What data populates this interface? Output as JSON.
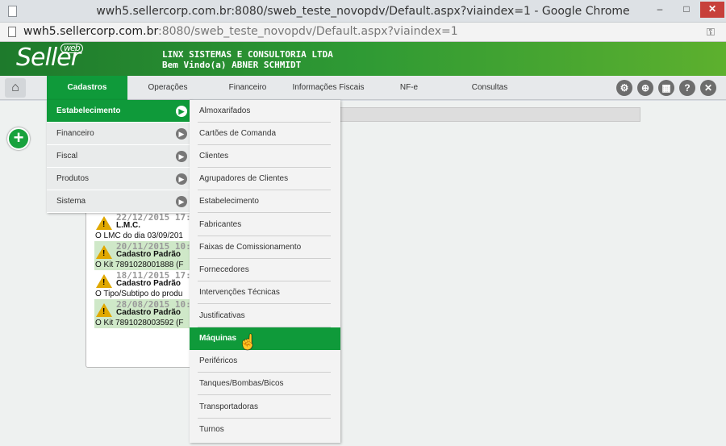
{
  "window": {
    "title": "wwh5.sellercorp.com.br:8080/sweb_teste_novopdv/Default.aspx?viaindex=1 - Google Chrome",
    "minimize": "–",
    "maximize": "□",
    "close": "✕"
  },
  "address": {
    "host": "wwh5.sellercorp.com.br",
    "path": ":8080/sweb_teste_novopdv/Default.aspx?viaindex=1"
  },
  "header": {
    "logo": "Seller",
    "logo_badge": "web",
    "company": "LINX SISTEMAS E CONSULTORIA LTDA",
    "welcome": "Bem Vindo(a) ABNER SCHMIDT"
  },
  "nav": {
    "items": [
      "Cadastros",
      "Operações",
      "Financeiro",
      "Informações Fiscais",
      "NF-e",
      "Consultas"
    ],
    "active": "Cadastros",
    "tools": [
      "gear-icon",
      "lock-icon",
      "calculator-icon",
      "help-icon",
      "close-icon"
    ],
    "tool_glyphs": [
      "⚙",
      "🔒",
      "▦",
      "?",
      "✕"
    ]
  },
  "menu_l1": {
    "items": [
      {
        "label": "Estabelecimento",
        "active": true
      },
      {
        "label": "Financeiro",
        "active": false
      },
      {
        "label": "Fiscal",
        "active": false
      },
      {
        "label": "Produtos",
        "active": false
      },
      {
        "label": "Sistema",
        "active": false
      }
    ]
  },
  "menu_l2": {
    "items": [
      "Almoxarifados",
      "Cartões de Comanda",
      "Clientes",
      "Agrupadores de Clientes",
      "Estabelecimento",
      "Fabricantes",
      "Faixas de Comissionamento",
      "Fornecedores",
      "Intervenções Técnicas",
      "Justificativas",
      "Máquinas",
      "Periféricos",
      "Tanques/Bombas/Bicos",
      "Transportadoras",
      "Turnos"
    ],
    "active": "Máquinas"
  },
  "notifications": [
    {
      "date": "22/12/2015 17:5",
      "subject": "L.M.C.",
      "desc": "O LMC do dia 03/09/201",
      "highlight": false
    },
    {
      "date": "20/11/2015 10:3",
      "subject": "Cadastro Padrão",
      "desc": "O Kit 7891028001888 (F",
      "highlight": true
    },
    {
      "date": "18/11/2015 17:1",
      "subject": "Cadastro Padrão",
      "desc": "O Tipo/Subtipo do produ",
      "highlight": false
    },
    {
      "date": "28/08/2015 10:3",
      "subject": "Cadastro Padrão",
      "desc": "O Kit 7891028003592 (F",
      "highlight": true
    }
  ],
  "add_button": "+",
  "colors": {
    "accent": "#0f9a3a",
    "header_start": "#1e7a2c",
    "header_end": "#5db02e"
  }
}
